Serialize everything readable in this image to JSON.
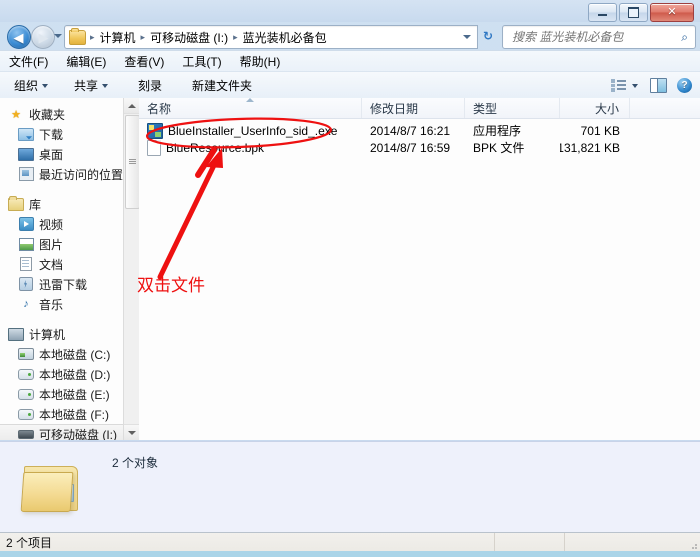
{
  "window": {
    "controls": {
      "minimize": "–",
      "maximize": "□",
      "close": "✕"
    }
  },
  "addressbar": {
    "back_glyph": "◀",
    "forward_glyph": "▶",
    "refresh_glyph": "↻",
    "crumbs": [
      {
        "label": "计算机"
      },
      {
        "label": "可移动磁盘 (I:)"
      },
      {
        "label": "蓝光装机必备包"
      }
    ],
    "separator": "▸"
  },
  "search": {
    "placeholder": "搜索 蓝光装机必备包",
    "value": "",
    "icon_glyph": "⌕"
  },
  "menubar": {
    "items": [
      {
        "label": "文件(F)"
      },
      {
        "label": "编辑(E)"
      },
      {
        "label": "查看(V)"
      },
      {
        "label": "工具(T)"
      },
      {
        "label": "帮助(H)"
      }
    ]
  },
  "toolbar": {
    "organize_label": "组织",
    "share_label": "共享",
    "burn_label": "刻录",
    "newfolder_label": "新建文件夹",
    "help_glyph": "?"
  },
  "navpane": {
    "sections": [
      {
        "header": {
          "label": "收藏夹",
          "icon": "star-icon"
        },
        "items": [
          {
            "label": "下载",
            "icon": "downloads-folder-icon"
          },
          {
            "label": "桌面",
            "icon": "desktop-icon"
          },
          {
            "label": "最近访问的位置",
            "icon": "recent-places-icon"
          }
        ]
      },
      {
        "header": {
          "label": "库",
          "icon": "library-folder-icon"
        },
        "items": [
          {
            "label": "视频",
            "icon": "video-icon"
          },
          {
            "label": "图片",
            "icon": "picture-icon"
          },
          {
            "label": "文档",
            "icon": "document-icon"
          },
          {
            "label": "迅雷下载",
            "icon": "thunder-download-icon"
          },
          {
            "label": "音乐",
            "icon": "music-icon"
          }
        ]
      },
      {
        "header": {
          "label": "计算机",
          "icon": "computer-icon"
        },
        "items": [
          {
            "label": "本地磁盘 (C:)",
            "icon": "system-drive-icon"
          },
          {
            "label": "本地磁盘 (D:)",
            "icon": "drive-icon"
          },
          {
            "label": "本地磁盘 (E:)",
            "icon": "drive-icon"
          },
          {
            "label": "本地磁盘 (F:)",
            "icon": "drive-icon"
          },
          {
            "label": "可移动磁盘 (I:)",
            "icon": "usb-drive-icon",
            "selected": true
          }
        ]
      }
    ]
  },
  "filelist": {
    "columns": [
      {
        "key": "name",
        "label": "名称",
        "sorted": true
      },
      {
        "key": "date",
        "label": "修改日期"
      },
      {
        "key": "type",
        "label": "类型"
      },
      {
        "key": "size",
        "label": "大小"
      }
    ],
    "rows": [
      {
        "name": "BlueInstaller_UserInfo_sid_.exe",
        "date": "2014/8/7 16:21",
        "type": "应用程序",
        "size": "701 KB",
        "icon": "exe-file-icon"
      },
      {
        "name": "BlueResource.bpk",
        "date": "2014/8/7 16:59",
        "type": "BPK 文件",
        "size": "131,821 KB",
        "icon": "generic-file-icon"
      }
    ]
  },
  "details": {
    "object_count": "2 个对象"
  },
  "statusbar": {
    "item_count": "2 个项目"
  },
  "annotation": {
    "text": "双击文件",
    "color": "#ee1111"
  }
}
